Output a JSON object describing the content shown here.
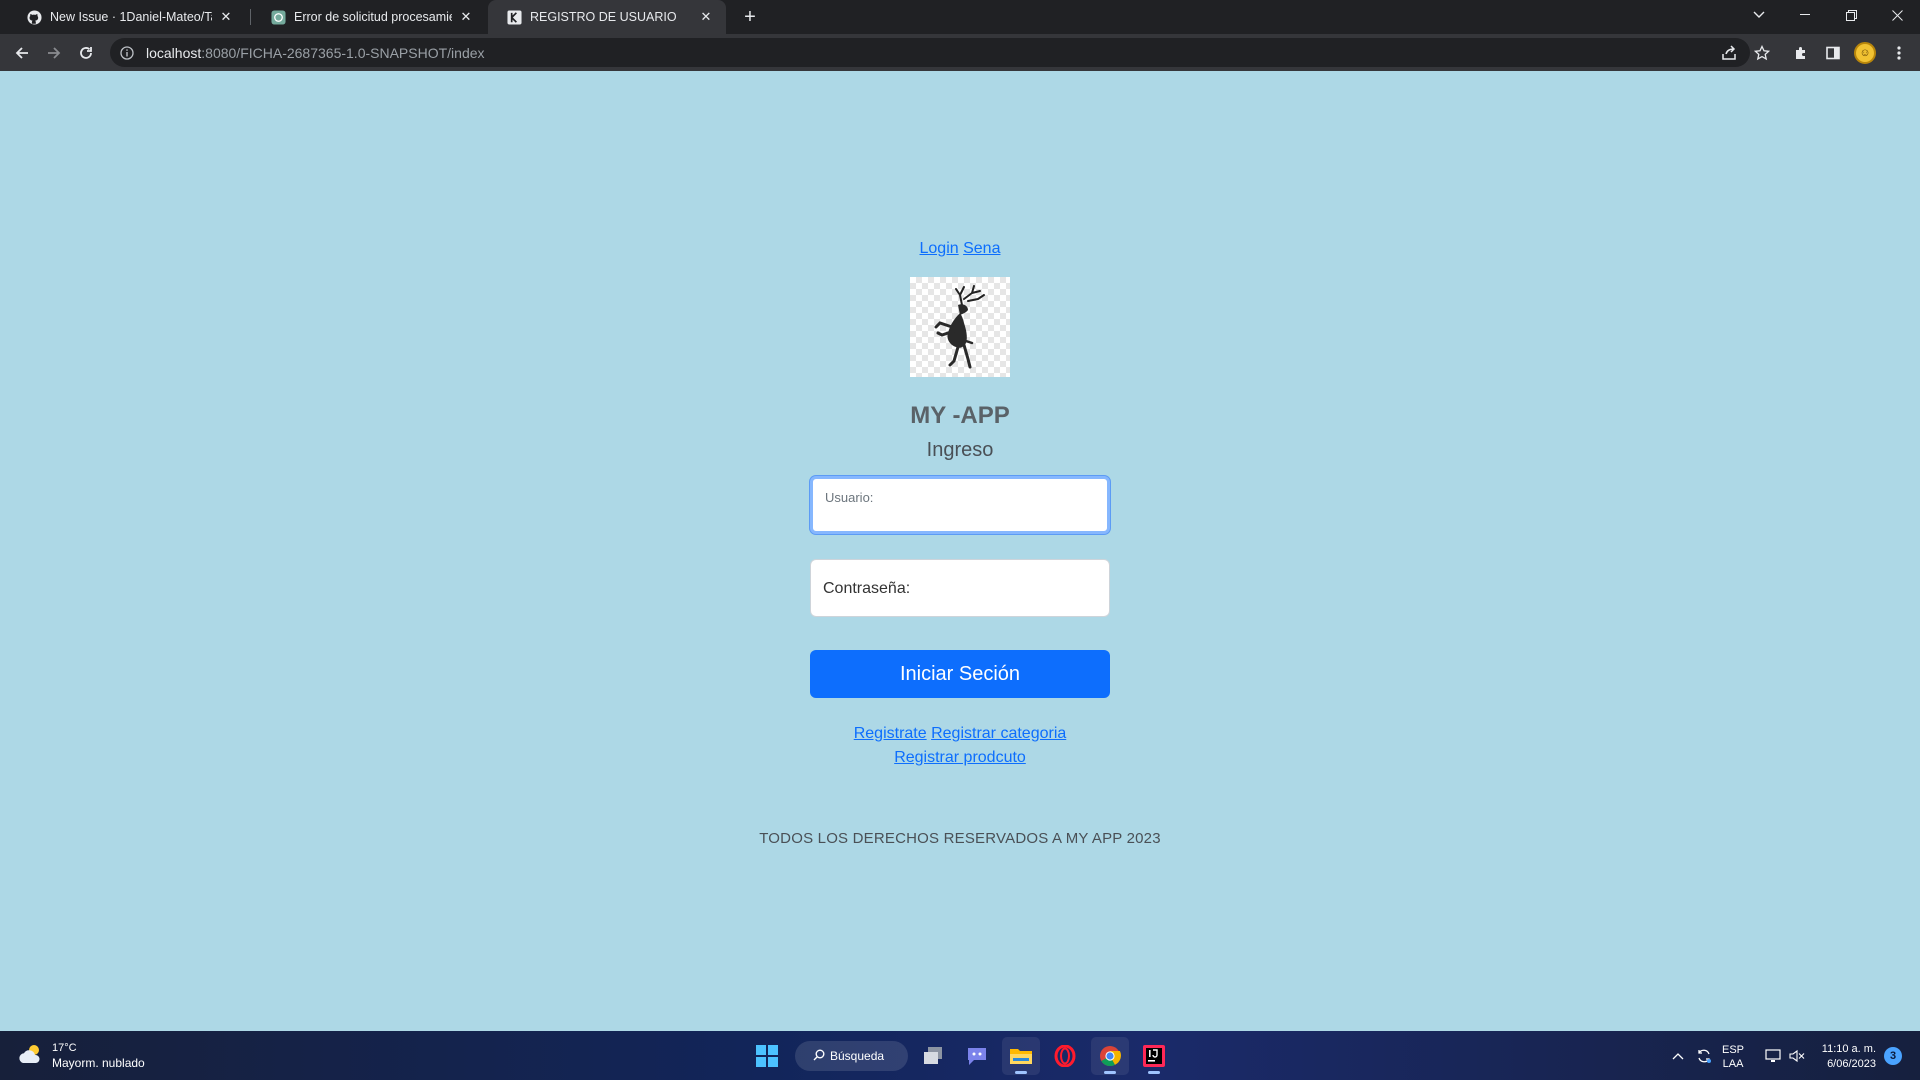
{
  "browser": {
    "tabs": [
      {
        "title": "New Issue · 1Daniel-Mateo/Taller",
        "icon": "github-icon",
        "active": false
      },
      {
        "title": "Error de solicitud procesamiento",
        "icon": "chatgpt-icon",
        "active": false
      },
      {
        "title": "REGISTRO DE USUARIO",
        "icon": "page-icon",
        "active": true
      }
    ],
    "address": {
      "host": "localhost",
      "rest": ":8080/FICHA-2687365-1.0-SNAPSHOT/index"
    }
  },
  "page": {
    "top_links": [
      "Login",
      "Sena"
    ],
    "app_title": "MY -APP",
    "subtitle": "Ingreso",
    "usuario_label": "Usuario:",
    "password_label": "Contraseña:",
    "submit_label": "Iniciar Seción",
    "bottom_links": [
      "Registrate",
      "Registrar categoria",
      "Registrar prodcuto"
    ],
    "footer": "TODOS LOS DERECHOS RESERVADOS A MY APP 2023"
  },
  "taskbar": {
    "weather_temp": "17°C",
    "weather_condition": "Mayorm. nublado",
    "search_label": "Búsqueda",
    "lang_top": "ESP",
    "lang_bottom": "LAA",
    "time": "11:10 a. m.",
    "date": "6/06/2023",
    "notification_count": "3"
  },
  "colors": {
    "page_background": "#add8e6",
    "primary_button": "#0d6efd",
    "link": "#0d6efd"
  }
}
